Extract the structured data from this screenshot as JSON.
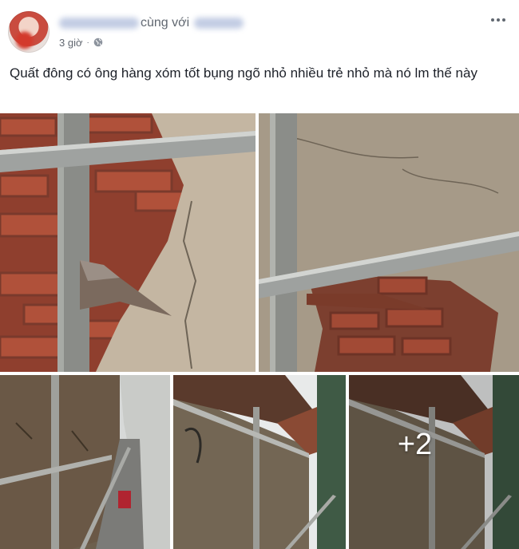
{
  "post": {
    "with_text": "cùng với",
    "time": "3 giờ",
    "separator": "·",
    "privacy_icon": "globe-icon",
    "menu_icon": "more-horizontal-icon",
    "caption": "Quất đông có ông hàng xóm tốt bụng ngõ nhỏ nhiều trẻ nhỏ mà nó lm thế này",
    "photos": {
      "extra_count": "+2"
    }
  },
  "colors": {
    "name_link": "#385898",
    "secondary_text": "#616770",
    "body_text": "#1d2129"
  }
}
